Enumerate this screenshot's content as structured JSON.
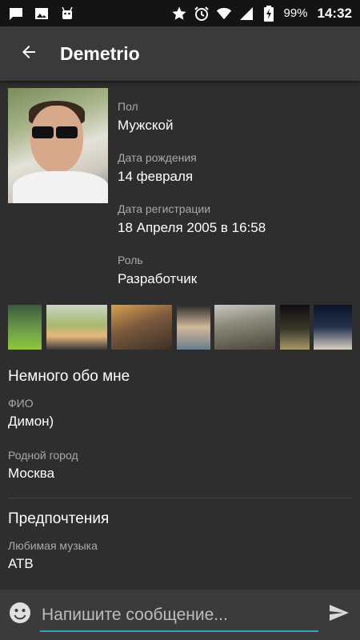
{
  "status_bar": {
    "left_icons": [
      "chat-notification-icon",
      "image-notification-icon",
      "android-debug-icon"
    ],
    "right_icons": [
      "star-icon",
      "alarm-icon",
      "wifi-icon",
      "signal-icon",
      "battery-charging-icon"
    ],
    "battery": "99%",
    "time": "14:32"
  },
  "toolbar": {
    "title": "Demetrio"
  },
  "profile": {
    "fields": [
      {
        "label": "Пол",
        "value": "Мужской"
      },
      {
        "label": "Дата рождения",
        "value": "14 февраля"
      },
      {
        "label": "Дата регистрации",
        "value": "18 Апреля 2005 в 16:58"
      },
      {
        "label": "Роль",
        "value": "Разработчик"
      }
    ]
  },
  "about": {
    "title": "Немного обо мне",
    "fields": [
      {
        "label": "ФИО",
        "value": "Димон)"
      },
      {
        "label": "Родной город",
        "value": "Москва"
      }
    ]
  },
  "preferences": {
    "title": "Предпочтения",
    "fields": [
      {
        "label": "Любимая музыка",
        "value": "АТВ"
      }
    ]
  },
  "composer": {
    "placeholder": "Напишите сообщение...",
    "accent_color": "#37a3b6"
  }
}
